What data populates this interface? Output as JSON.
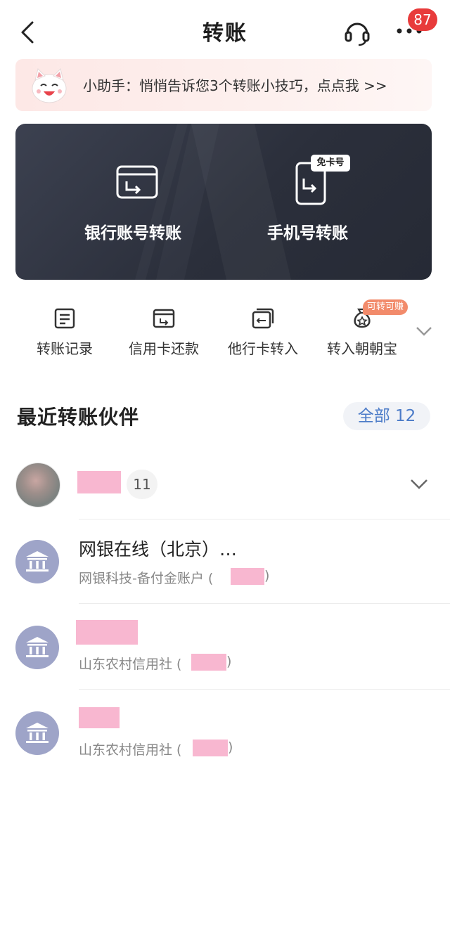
{
  "header": {
    "title": "转账",
    "notification_count": "87"
  },
  "tip": {
    "text": "小助手：悄悄告诉您3个转账小技巧，点点我 >>"
  },
  "transfer_card": {
    "bank_account_label": "银行账号转账",
    "phone_label": "手机号转账",
    "free_card_tag": "免卡号"
  },
  "quick_actions": {
    "items": [
      {
        "label": "转账记录",
        "icon": "list-doc-icon"
      },
      {
        "label": "信用卡还款",
        "icon": "credit-card-icon"
      },
      {
        "label": "他行卡转入",
        "icon": "card-transfer-in-icon"
      },
      {
        "label": "转入朝朝宝",
        "icon": "money-bag-icon"
      }
    ],
    "earn_tag": "可转可赚"
  },
  "recent": {
    "title": "最近转账伙伴",
    "all_label": "全部 12",
    "partners": [
      {
        "count": "11"
      },
      {
        "name": "网银在线（北京）…",
        "sub_prefix": "网银科技-备付金账户 (",
        "sub_suffix": ")"
      },
      {
        "sub_prefix": "山东农村信用社 (",
        "sub_suffix": ")"
      },
      {
        "sub_prefix": "山东农村信用社 (",
        "sub_suffix": ")"
      }
    ]
  },
  "colors": {
    "accent": "#4b7bc8",
    "badge": "#e83b3b",
    "mask": "#f8b7d0",
    "bank_avatar": "#9ea4c8",
    "card_bg": "#2b2f3b"
  }
}
